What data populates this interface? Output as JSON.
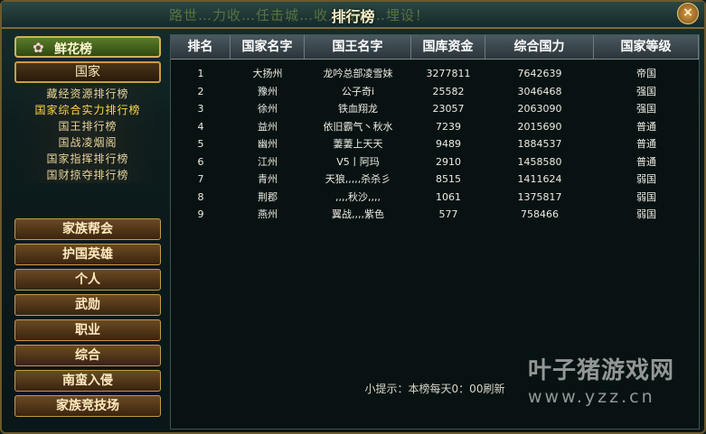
{
  "window": {
    "title": "排行榜",
    "marquee": "路世…力收…任击城…收人侵者…埋设！",
    "close_glyph": "×"
  },
  "sidebar": {
    "flower_label": "鲜花榜",
    "flower_icon": "rose-icon",
    "category": "国家",
    "sub_items": [
      {
        "label": "藏经资源排行榜",
        "active": false
      },
      {
        "label": "国家综合实力排行榜",
        "active": true
      },
      {
        "label": "国王排行榜",
        "active": false
      },
      {
        "label": "国战凌烟阁",
        "active": false
      },
      {
        "label": "国家指挥排行榜",
        "active": false
      },
      {
        "label": "国财掠夺排行榜",
        "active": false
      }
    ],
    "menu": [
      "家族帮会",
      "护国英雄",
      "个人",
      "武勋",
      "职业",
      "综合",
      "南蛮入侵",
      "家族竞技场"
    ]
  },
  "table": {
    "columns": [
      "排名",
      "国家名字",
      "国王名字",
      "国库资金",
      "综合国力",
      "国家等级"
    ],
    "rows": [
      [
        "1",
        "大扬州",
        "龙吟总部凌雪妹",
        "3277811",
        "7642639",
        "帝国"
      ],
      [
        "2",
        "豫州",
        "公子奇i",
        "25582",
        "3046468",
        "强国"
      ],
      [
        "3",
        "徐州",
        "铁血翔龙",
        "23057",
        "2063090",
        "强国"
      ],
      [
        "4",
        "益州",
        "依旧霸气丶秋水",
        "7239",
        "2015690",
        "普通"
      ],
      [
        "5",
        "幽州",
        "萋萋上天天",
        "9489",
        "1884537",
        "普通"
      ],
      [
        "6",
        "江州",
        "V5丨阿玛",
        "2910",
        "1458580",
        "普通"
      ],
      [
        "7",
        "青州",
        "天狼,,,,,杀杀彡",
        "8515",
        "1411624",
        "弱国"
      ],
      [
        "8",
        "荆郡",
        ",,,,秋沙,,,,",
        "1061",
        "1375817",
        "弱国"
      ],
      [
        "9",
        "燕州",
        "翼战,,,,紫色",
        "577",
        "758466",
        "弱国"
      ]
    ]
  },
  "tip": "小提示：本榜每天0：00刷新",
  "watermark": {
    "line1": "叶子猪游戏网",
    "line2": "www.yzz.cn"
  }
}
